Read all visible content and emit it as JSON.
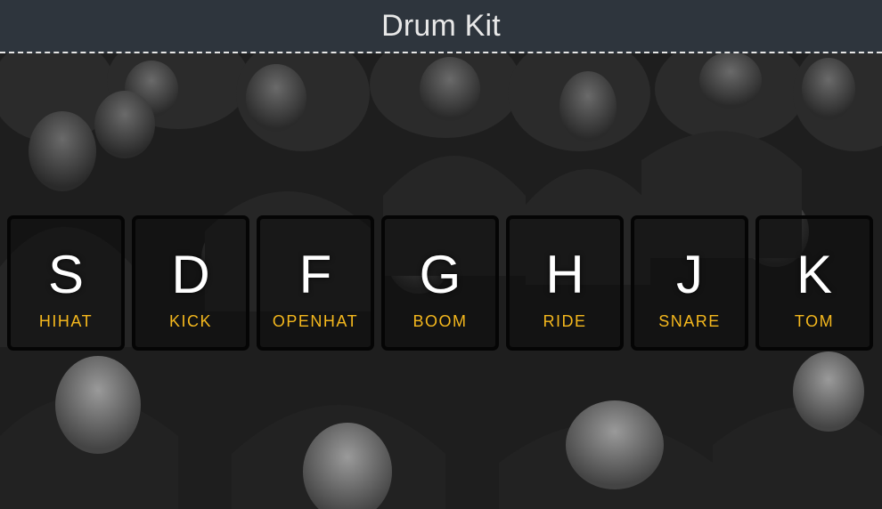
{
  "header": {
    "title": "Drum Kit"
  },
  "colors": {
    "header_bg": "#2e353d",
    "sound_label": "#f5b81d",
    "key_letter": "#ffffff",
    "key_border": "#050505"
  },
  "keys": [
    {
      "letter": "S",
      "sound": "HIHAT"
    },
    {
      "letter": "D",
      "sound": "KICK"
    },
    {
      "letter": "F",
      "sound": "OPENHAT"
    },
    {
      "letter": "G",
      "sound": "BOOM"
    },
    {
      "letter": "H",
      "sound": "RIDE"
    },
    {
      "letter": "J",
      "sound": "SNARE"
    },
    {
      "letter": "K",
      "sound": "TOM"
    }
  ]
}
